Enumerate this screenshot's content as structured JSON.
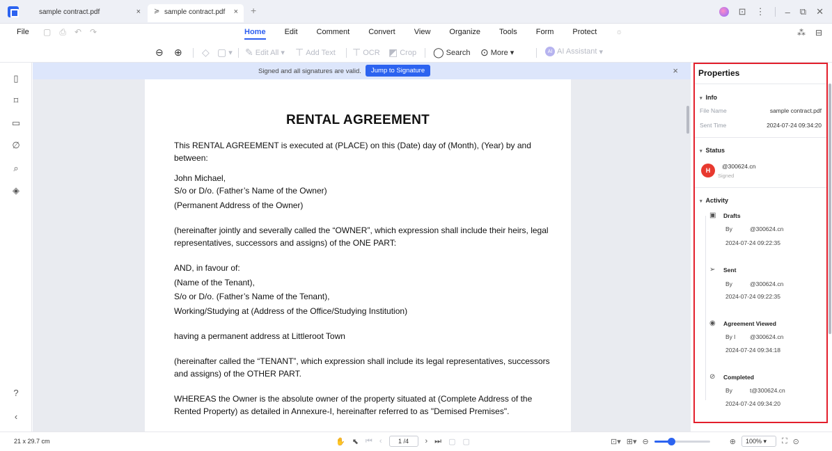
{
  "tabs": [
    {
      "label": "sample contract.pdf",
      "close": "×"
    },
    {
      "label": "sample contract.pdf",
      "close": "×"
    }
  ],
  "add_tab": "+",
  "window": {
    "minimize": "–",
    "restore": "⧉",
    "close": "✕"
  },
  "menu": {
    "file": "File",
    "items": [
      "Home",
      "Edit",
      "Comment",
      "Convert",
      "View",
      "Organize",
      "Tools",
      "Form",
      "Protect"
    ],
    "active": "Home"
  },
  "toolbar": {
    "edit_all": "Edit All",
    "add_text": "Add Text",
    "ocr": "OCR",
    "crop": "Crop",
    "search": "Search",
    "more": "More",
    "ai_assistant": "AI Assistant",
    "ai_badge": "AI"
  },
  "banner": {
    "text": "Signed and all signatures are valid.",
    "button": "Jump to Signature"
  },
  "document": {
    "title": "RENTAL AGREEMENT",
    "paragraphs": [
      "This RENTAL AGREEMENT is executed at (PLACE) on this (Date) day of (Month), (Year) by and between:",
      "John Michael,",
      "S/o or D/o. (Father’s Name of the Owner)",
      "(Permanent Address of the Owner)",
      "(hereinafter jointly and severally called the “OWNER”, which expression shall include their heirs, legal representatives, successors and assigns) of the ONE PART:",
      "AND, in favour of:",
      "(Name of the Tenant),",
      "S/o or D/o. (Father’s Name of the Tenant),",
      "Working/Studying at (Address of the Office/Studying Institution)",
      "having a permanent address at Littleroot Town",
      "(hereinafter called the “TENANT”, which expression shall include its legal representatives, successors and assigns) of the OTHER PART.",
      "WHEREAS the Owner is the absolute owner of the property situated at (Complete Address of the Rented Property) as detailed in Annexure-I, hereinafter referred to as \"Demised Premises\"."
    ]
  },
  "properties": {
    "title": "Properties",
    "info": {
      "heading": "Info",
      "file_name_label": "File Name",
      "file_name": "sample contract.pdf",
      "sent_time_label": "Sent Time",
      "sent_time": "2024-07-24 09:34:20"
    },
    "status": {
      "heading": "Status",
      "avatar": "H",
      "email": "@300624.cn",
      "state": "Signed"
    },
    "activity": {
      "heading": "Activity",
      "events": [
        {
          "title": "Drafts",
          "by": "By",
          "email": "@300624.cn",
          "time": "2024-07-24 09:22:35"
        },
        {
          "title": "Sent",
          "by": "By",
          "email": "@300624.cn",
          "time": "2024-07-24 09:22:35"
        },
        {
          "title": "Agreement Viewed",
          "by": "By l",
          "email": "@300624.cn",
          "time": "2024-07-24 09:34:18"
        },
        {
          "title": "Completed",
          "by": "By",
          "email": "t@300624.cn",
          "time": "2024-07-24 09:34:20"
        }
      ]
    }
  },
  "statusbar": {
    "page_size": "21 x 29.7 cm",
    "page": "1 /4",
    "zoom": "100%",
    "zoom_fraction": 0.3
  },
  "colors": {
    "accent": "#2c63f0",
    "highlight_border": "#e31e2b",
    "avatar": "#e8392f"
  }
}
